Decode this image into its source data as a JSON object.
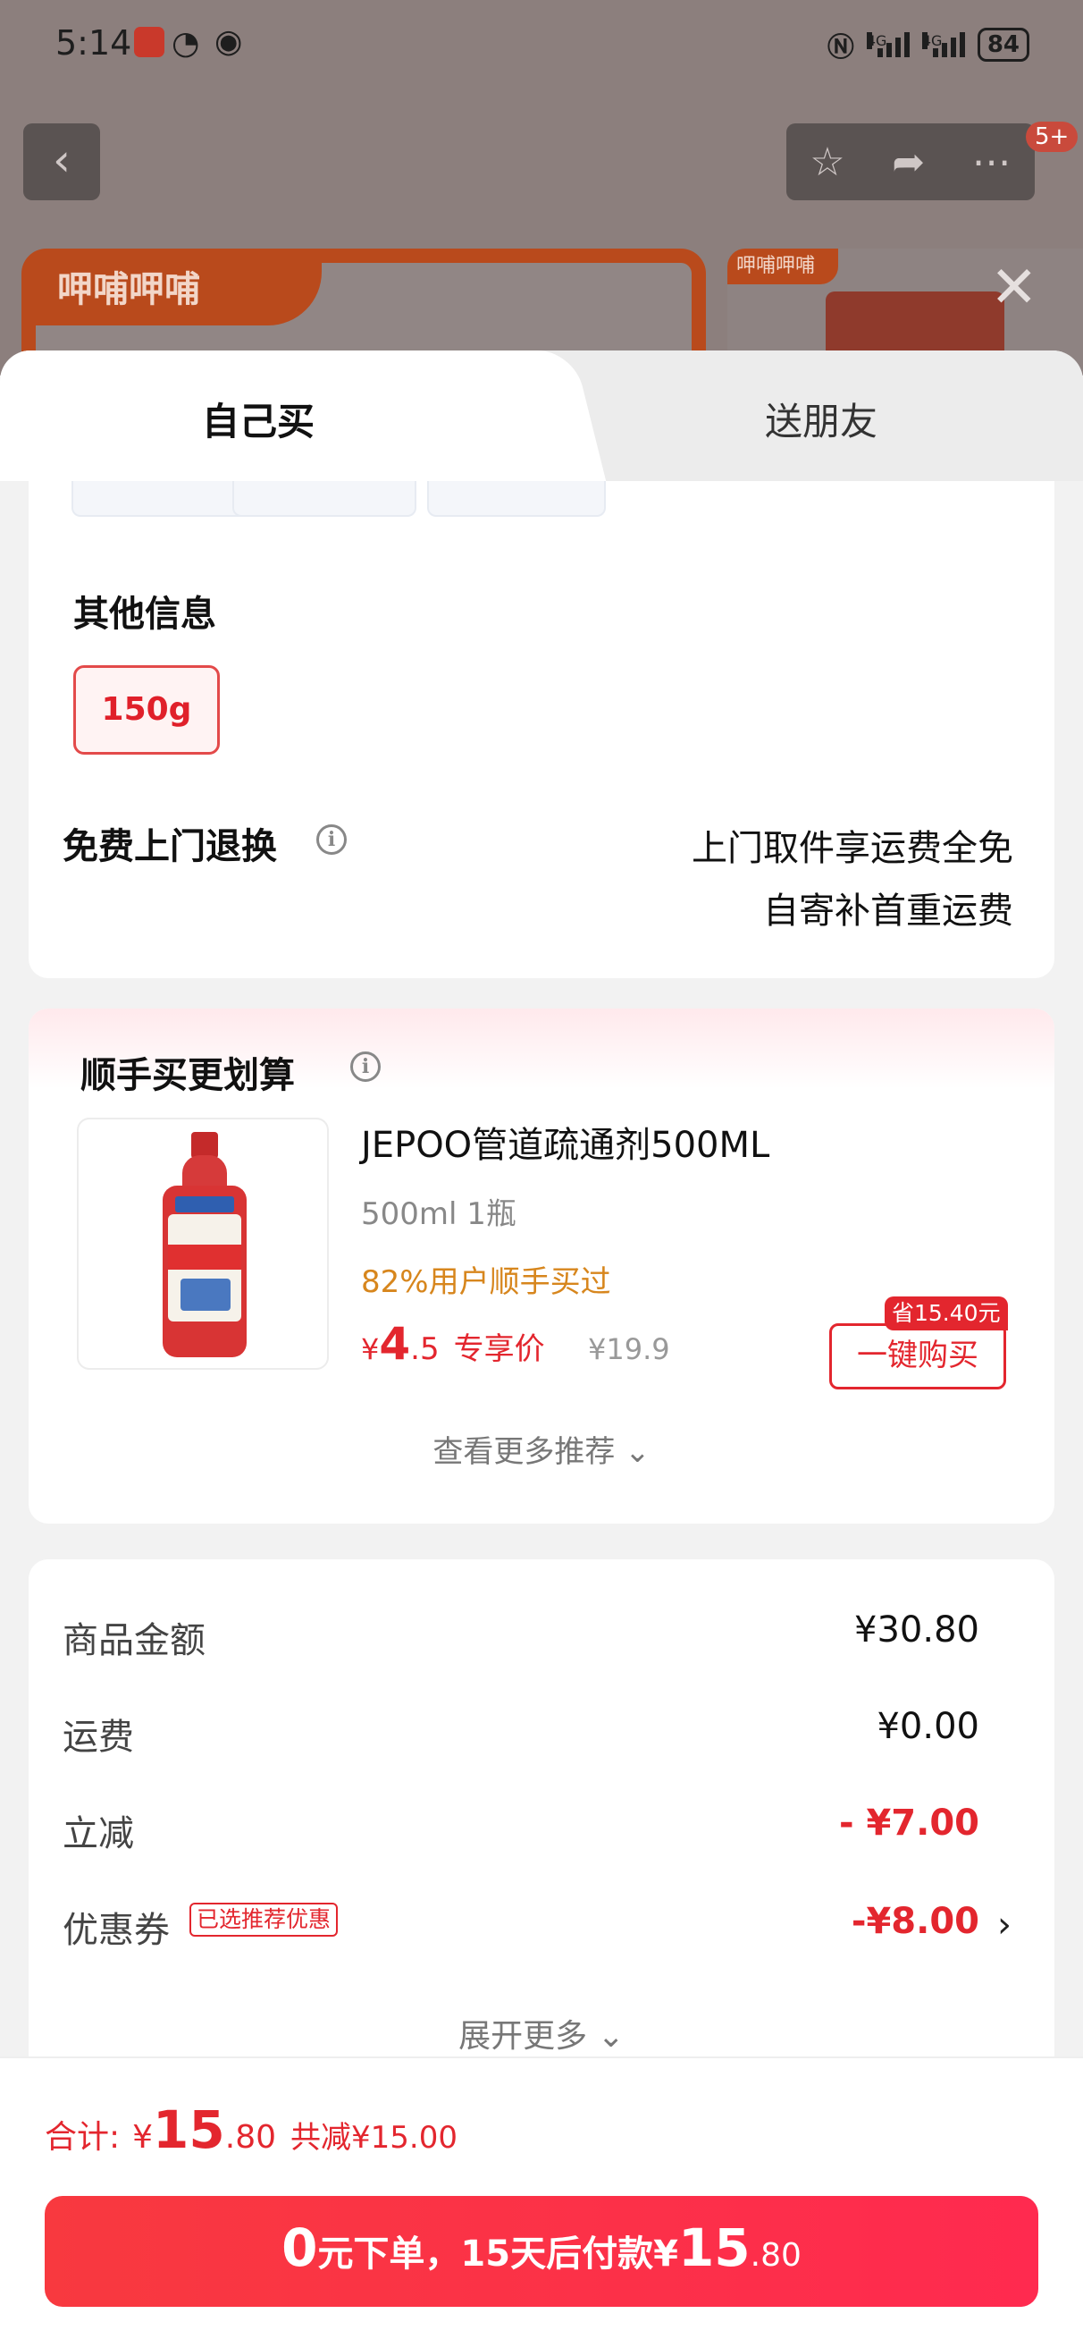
{
  "status_bar": {
    "time": "5:14",
    "network1": "4G",
    "network2": "4G",
    "battery": "84"
  },
  "background": {
    "badge": "5+",
    "brand_logo": "呷哺呷哺",
    "brand_logo_small": "呷哺呷哺"
  },
  "tabs": {
    "mine": "自己买",
    "friend": "送朋友"
  },
  "options": {
    "other_info_title": "其他信息",
    "selected_option": "150g"
  },
  "return_policy": {
    "title": "免费上门退换",
    "line1": "上门取件享运费全免",
    "line2": "自寄补首重运费"
  },
  "bundle": {
    "title": "顺手买更划算",
    "product_name": "JEPOO管道疏通剂500ML",
    "spec": "500ml 1瓶",
    "social_proof": "82%用户顺手买过",
    "price_yen": "¥",
    "price_int": "4",
    "price_dec": ".5",
    "price_tag": "专享价",
    "original_price": "¥19.9",
    "save_tag": "省15.40元",
    "buy_button": "一键购买",
    "more_recommendations": "查看更多推荐"
  },
  "summary": {
    "goods_label": "商品金额",
    "goods_value": "¥30.80",
    "shipping_label": "运费",
    "shipping_value": "¥0.00",
    "discount_label": "立减",
    "discount_value": "- ¥7.00",
    "coupon_label": "优惠券",
    "coupon_tag": "已选推荐优惠",
    "coupon_value": "-¥8.00",
    "expand_more": "展开更多"
  },
  "bottom": {
    "total_label": "合计:",
    "total_yen": "¥",
    "total_int": "15",
    "total_dec": ".80",
    "total_saved": "共减¥15.00",
    "pay_part1": "0",
    "pay_part2": "元下单，15天后付款¥",
    "pay_part3": "15",
    "pay_part4": ".80"
  },
  "colors": {
    "accent_red": "#e3262e",
    "social_orange": "#d7861d"
  },
  "icons": [
    "back-icon",
    "star-icon",
    "share-icon",
    "more-icon",
    "close-icon",
    "info-icon",
    "chevron-down-icon",
    "chevron-right-icon"
  ]
}
